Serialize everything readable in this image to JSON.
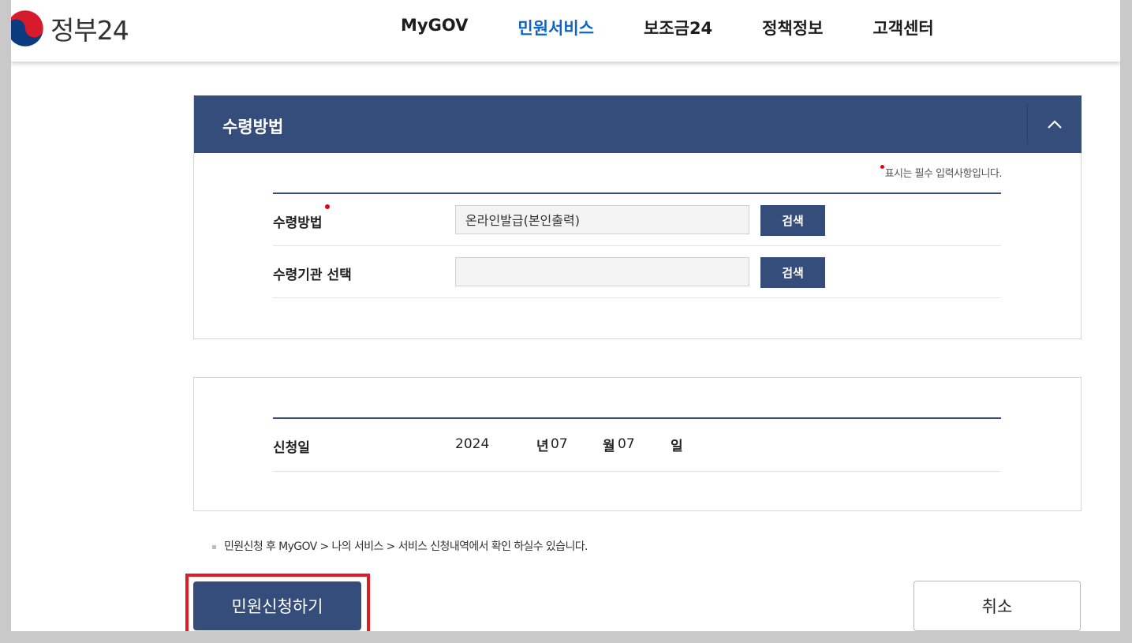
{
  "header": {
    "logo_text": "정부24",
    "nav": [
      {
        "label": "MyGOV"
      },
      {
        "label": "민원서비스"
      },
      {
        "label": "보조금24"
      },
      {
        "label": "정책정보"
      },
      {
        "label": "고객센터"
      }
    ],
    "active_color": "#0f63c4"
  },
  "receipt_section": {
    "title": "수령방법",
    "required_note": "표시는 필수 입력사항입니다.",
    "rows": [
      {
        "label": "수령방법",
        "value": "온라인발급(본인출력)",
        "button": "검색",
        "required": true
      },
      {
        "label": "수령기관 선택",
        "value": "",
        "button": "검색",
        "required": false
      }
    ]
  },
  "date_section": {
    "label": "신청일",
    "year": "2024",
    "year_unit": "년",
    "month": "07",
    "month_unit": "월",
    "day": "07",
    "day_unit": "일"
  },
  "notice": "민원신청 후 MyGOV > 나의 서비스 > 서비스 신청내역에서 확인 하실수 있습니다.",
  "actions": {
    "submit": "민원신청하기",
    "cancel": "취소"
  },
  "colors": {
    "primary": "#344d7a",
    "required_dot": "#e60012",
    "highlight": "#e01c26"
  }
}
